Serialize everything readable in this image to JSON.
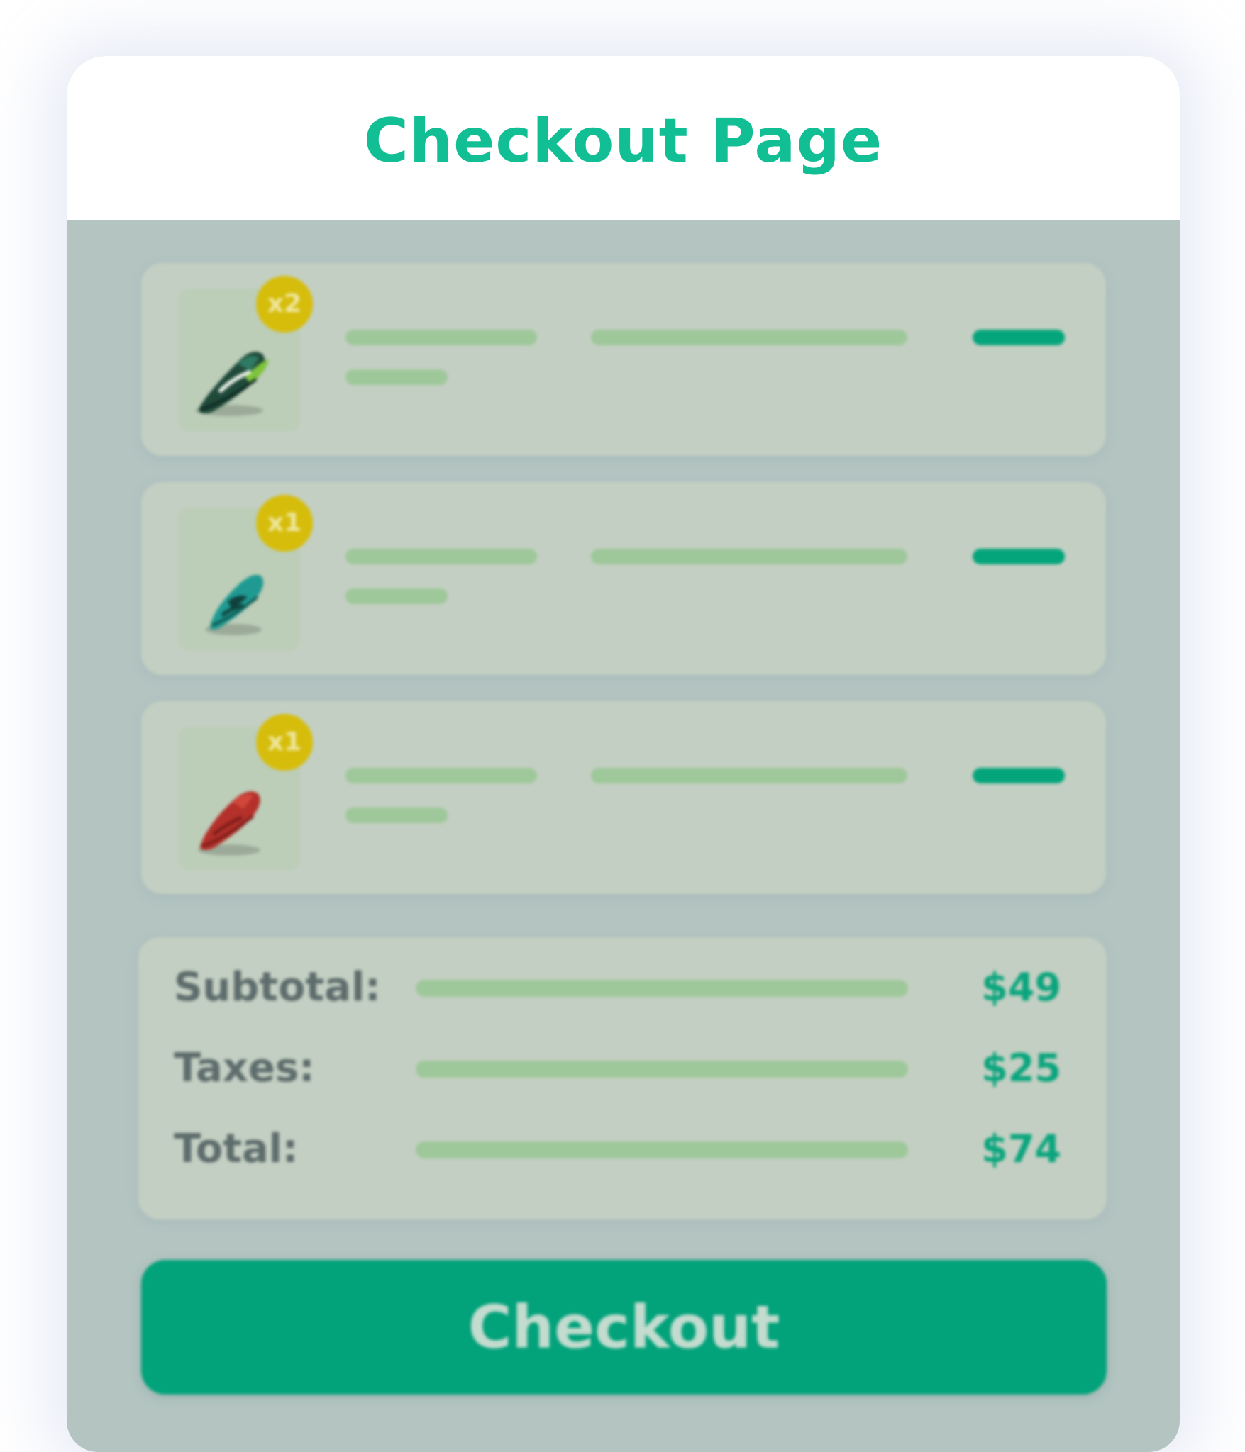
{
  "page": {
    "title": "Checkout Page"
  },
  "cart": {
    "items": [
      {
        "quantity": "x2",
        "icon": "sneaker-dark-green-icon",
        "color": "#1f4a3a"
      },
      {
        "quantity": "x1",
        "icon": "sneaker-teal-icon",
        "color": "#1f9a92"
      },
      {
        "quantity": "x1",
        "icon": "sneaker-red-icon",
        "color": "#b4302a"
      }
    ]
  },
  "summary": {
    "subtotal": {
      "label": "Subtotal:",
      "value": "$49"
    },
    "taxes": {
      "label": "Taxes:",
      "value": "$25"
    },
    "total": {
      "label": "Total:",
      "value": "$74"
    }
  },
  "checkout": {
    "label": "Checkout"
  },
  "colors": {
    "accent": "#12bf94",
    "button": "#02a27a",
    "badge": "#d6bd0c",
    "placeholder_bar": "#9ec89a"
  }
}
